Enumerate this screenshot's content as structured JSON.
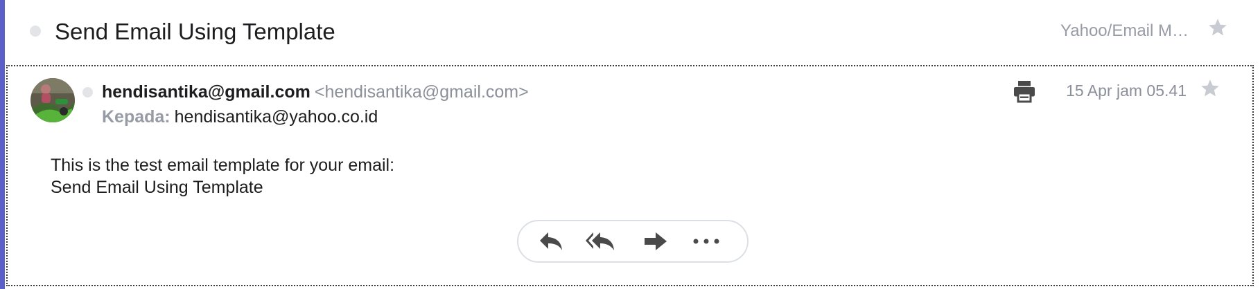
{
  "thread": {
    "subject": "Send Email Using Template",
    "folder": "Yahoo/Email M…"
  },
  "message": {
    "sender_name": "hendisantika@gmail.com",
    "sender_email": "<hendisantika@gmail.com>",
    "recipient_label": "Kepada:",
    "recipient_email": "hendisantika@yahoo.co.id",
    "date": "15 Apr jam 05.41",
    "body_lines": [
      "This is the test email template for your email:",
      "Send Email Using Template"
    ]
  },
  "actions": {
    "reply_icon": "reply-icon",
    "reply_all_icon": "reply-all-icon",
    "forward_icon": "forward-icon",
    "more_icon": "more-icon"
  },
  "colors": {
    "accent": "#5b5fc7",
    "icon": "#4a4a4a",
    "muted_text": "#8a8f99",
    "star": "#c8cbd1"
  }
}
